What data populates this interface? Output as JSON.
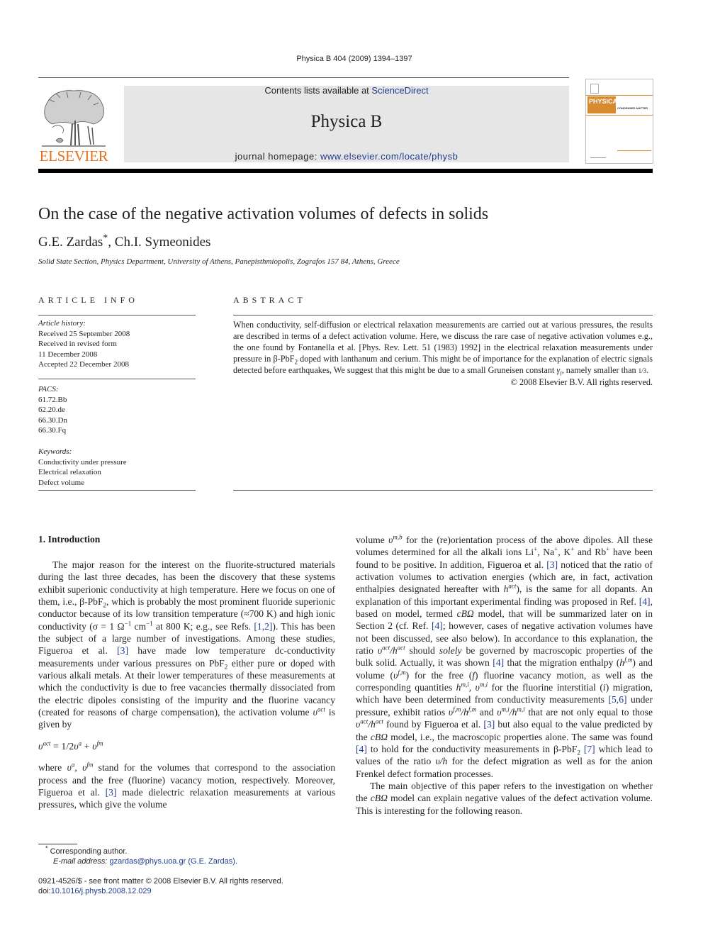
{
  "running_head": "Physica B 404 (2009) 1394–1397",
  "banner": {
    "contents_prefix": "Contents lists available at ",
    "contents_link": "ScienceDirect",
    "journal_name": "Physica B",
    "homepage_prefix": "journal homepage: ",
    "homepage_link": "www.elsevier.com/locate/physb"
  },
  "publisher": {
    "logo_word": "ELSEVIER",
    "logo_icon": "elsevier-tree-icon",
    "brand_color": "#e9711c"
  },
  "cover": {
    "title": "PHYSICA",
    "subtitle": "CONDENSED MATTER",
    "accent_color": "#d88a2e"
  },
  "article": {
    "title": "On the case of the negative activation volumes of defects in solids",
    "authors": "G.E. Zardas",
    "authors_mark": "*",
    "authors_rest": ", Ch.I. Symeonides",
    "affiliation": "Solid State Section, Physics Department, University of Athens, Panepisthmiopolis, Zografos 157 84, Athens, Greece"
  },
  "article_info": {
    "heading": "ARTICLE INFO",
    "history_label": "Article history:",
    "history": [
      "Received 25 September 2008",
      "Received in revised form",
      "11 December 2008",
      "Accepted 22 December 2008"
    ],
    "pacs_label": "PACS:",
    "pacs": [
      "61.72.Bb",
      "62.20.de",
      "66.30.Dn",
      "66.30.Fq"
    ],
    "keywords_label": "Keywords:",
    "keywords": [
      "Conductivity under pressure",
      "Electrical relaxation",
      "Defect volume"
    ]
  },
  "abstract": {
    "heading": "ABSTRACT",
    "text_1": "When conductivity, self-diffusion or electrical relaxation measurements are carried out at various pressures, the results are described in terms of a defect activation volume. Here, we discuss the rare case of negative activation volumes e.g., the one found by Fontanella et al. [Phys. Rev. Lett. 51 (1983) 1992] in the electrical relaxation measurements under pressure in β-PbF",
    "text_2": " doped with lanthanum and cerium. This might be of importance for the explanation of electric signals detected before earthquakes, We suggest that this might be due to a small Gruneisen constant ",
    "text_3": ", namely smaller than ",
    "fraction": "1/3",
    "copyright": "© 2008 Elsevier B.V. All rights reserved."
  },
  "intro": {
    "heading": "1.  Introduction",
    "p1_a": "The major reason for the interest on the fluorite-structured materials during the last three decades, has been the discovery that these systems exhibit superionic conductivity at high temperature. Here we focus on one of them, i.e., β-PbF",
    "p1_b": ", which is probably the most prominent fluoride superionic conductor because of its low transition temperature (≈700 K) and high ionic conductivity (σ = 1 Ω",
    "p1_c": " cm",
    "p1_d": " at 800 K; e.g., see Refs. ",
    "ref_12": "[1,2]",
    "p1_e": "). This has been the subject of a large number of investigations. Among these studies, Figueroa et al. ",
    "ref_3": "[3]",
    "p1_f": " have made low temperature dc-conductivity measurements under various pressures on PbF",
    "p1_g": " either pure or doped with various alkali metals. At their lower temperatures of these measurements at which the conductivity is due to free vacancies thermally dissociated from the electric dipoles consisting of the impurity and the fluorine vacancy (created for reasons of charge compensation), the activation volume ",
    "p1_h": " is given by",
    "equation": "υ^act = 1/2υ^a + υ^fm",
    "p2_a": "where ",
    "p2_b": " stand for the volumes that correspond to the association process and the free (fluorine) vacancy motion, respectively. Moreover, Figueroa et al. ",
    "p2_c": " made dielectric relaxation measurements at various pressures, which give the volume ",
    "p2_d": " for the (re)orientation process of the above dipoles. All these volumes determined for all the alkali ions Li",
    "p2_e": "have been found to be positive. In addition, Figueroa et al. ",
    "p2_f": " noticed that the ratio of activation volumes to activation energies (which are, in fact, activation enthalpies designated hereafter with ",
    "p2_g": "), is the same for all dopants. An explanation of this important experimental finding was proposed in Ref. ",
    "ref_4": "[4]",
    "p2_h": ", based on model, termed ",
    "model": "cBΩ",
    "p2_i": " model, that will be summarized later on in Section 2 (cf. Ref. ",
    "p2_j": "; however, cases of negative activation volumes have not been discussed, see also below). In accordance to this explanation, the ratio ",
    "p2_k": " should ",
    "solely": "solely",
    "p2_l": " be governed by macroscopic properties of the bulk solid. Actually, it was shown ",
    "p2_m": " that the migration enthalpy (",
    "p2_n": ") and volume (",
    "p2_o": ") for the free (",
    "p2_p": ") fluorine vacancy motion, as well as the corresponding quantities ",
    "p2_q": " for the fluorine interstitial (",
    "p2_r": ") migration, which have been determined from conductivity measurements ",
    "ref_56": "[5,6]",
    "p2_s": " under pressure, exhibit ratios ",
    "p2_t": " that are not only equal to those ",
    "p2_u": " found by Figueroa et al. ",
    "p2_v": " but also equal to the value predicted by the ",
    "p2_w": " model, i.e., the macroscopic properties alone. The same was found ",
    "p2_x": " to hold for the conductivity measurements in β-PbF",
    "ref_7": "[7]",
    "p2_y": " which lead to values of the ratio ",
    "p2_z": " for the defect migration as well as for the anion Frenkel defect formation processes.",
    "p3_a": "The main objective of this paper refers to the investigation on whether the ",
    "p3_b": " model can explain negative values of the defect activation volume. This is interesting for the following reason."
  },
  "footnotes": {
    "corresponding": "Corresponding author.",
    "email_label": "E-mail address:",
    "email": "gzardas@phys.uoa.gr (G.E. Zardas).",
    "front_matter": "0921-4526/$ - see front matter © 2008 Elsevier B.V. All rights reserved.",
    "doi_prefix": "doi:",
    "doi": "10.1016/j.physb.2008.12.029"
  }
}
